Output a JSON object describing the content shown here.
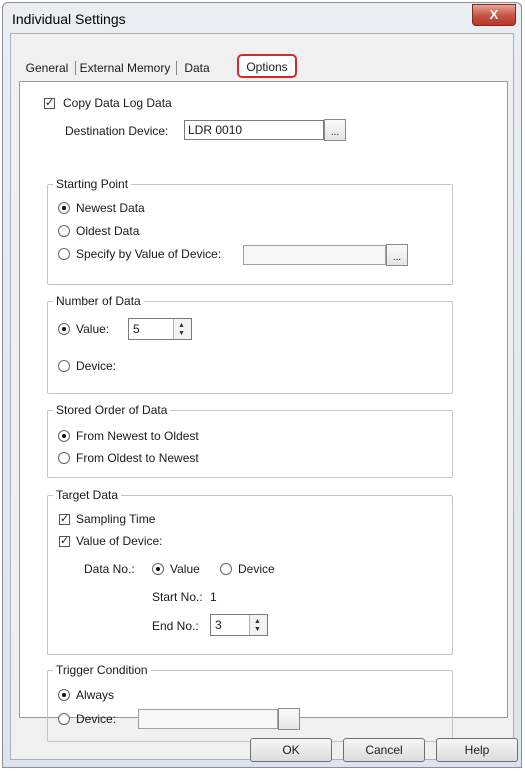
{
  "window": {
    "title": "Individual Settings",
    "close_glyph": "X"
  },
  "tabs": [
    {
      "label": "General"
    },
    {
      "label": "External Memory"
    },
    {
      "label": "Data"
    },
    {
      "label": "Options"
    }
  ],
  "copy_data_log": {
    "label": "Copy Data Log Data",
    "checked": true
  },
  "destination": {
    "label": "Destination Device:",
    "value": "LDR 0010",
    "browse": "..."
  },
  "starting_point": {
    "title": "Starting Point",
    "newest": "Newest Data",
    "oldest": "Oldest Data",
    "specify": "Specify by Value of Device:",
    "specify_value": "",
    "browse": "...",
    "selected": "Newest Data"
  },
  "number_of_data": {
    "title": "Number of Data",
    "value_label": "Value:",
    "value": "5",
    "device_label": "Device:",
    "selected": "Value:"
  },
  "stored_order": {
    "title": "Stored Order of Data",
    "newest_to_oldest": "From Newest to Oldest",
    "oldest_to_newest": "From Oldest to Newest",
    "selected": "From Newest to Oldest"
  },
  "target_data": {
    "title": "Target Data",
    "sampling_time": "Sampling Time",
    "value_of_device": "Value of Device:",
    "data_no_label": "Data No.:",
    "data_no_value": "Value",
    "data_no_device": "Device",
    "start_no_label": "Start No.:",
    "start_no_value": "1",
    "end_no_label": "End No.:",
    "end_no_value": "3"
  },
  "trigger": {
    "title": "Trigger Condition",
    "always": "Always",
    "device_label": "Device:",
    "device_value": "",
    "selected": "Always"
  },
  "buttons": {
    "ok": "OK",
    "cancel": "Cancel",
    "help": "Help"
  },
  "colors": {
    "highlight_red": "#d9262a",
    "close_red": "#c75040"
  }
}
